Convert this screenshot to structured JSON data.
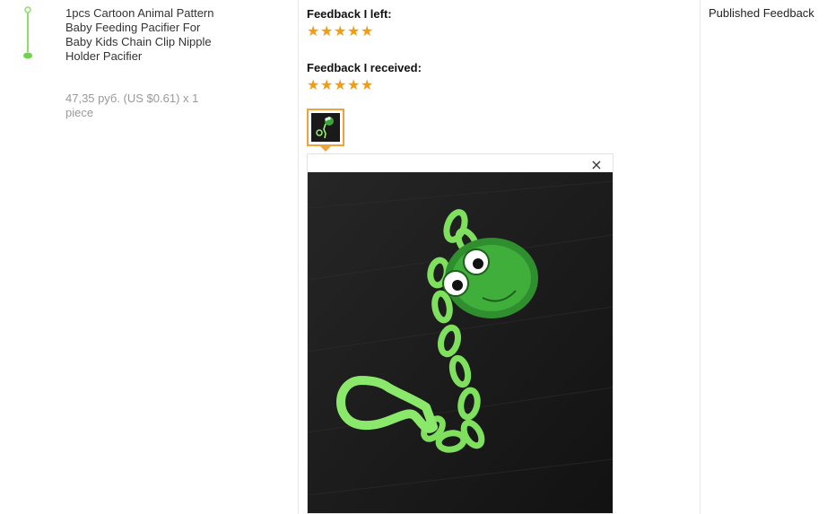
{
  "product": {
    "title": "1pcs Cartoon Animal Pattern Baby Feeding Pacifier For Baby Kids Chain Clip Nipple Holder Pacifier",
    "price_line": "47,35 руб. (US $0.61) x 1 piece",
    "thumbnail_icon": "pacifier-clip-thumbnail"
  },
  "feedback": {
    "left_label": "Feedback I left:",
    "left_rating": 5,
    "received_label": "Feedback I received:",
    "received_rating": 5,
    "star_glyph": "★",
    "star_color": "#f29c12"
  },
  "photo": {
    "thumb_icon": "frog-pacifier-clip-photo",
    "close_glyph": "×",
    "accent": "#f0a33a"
  },
  "status": {
    "label": "Published Feedback"
  }
}
